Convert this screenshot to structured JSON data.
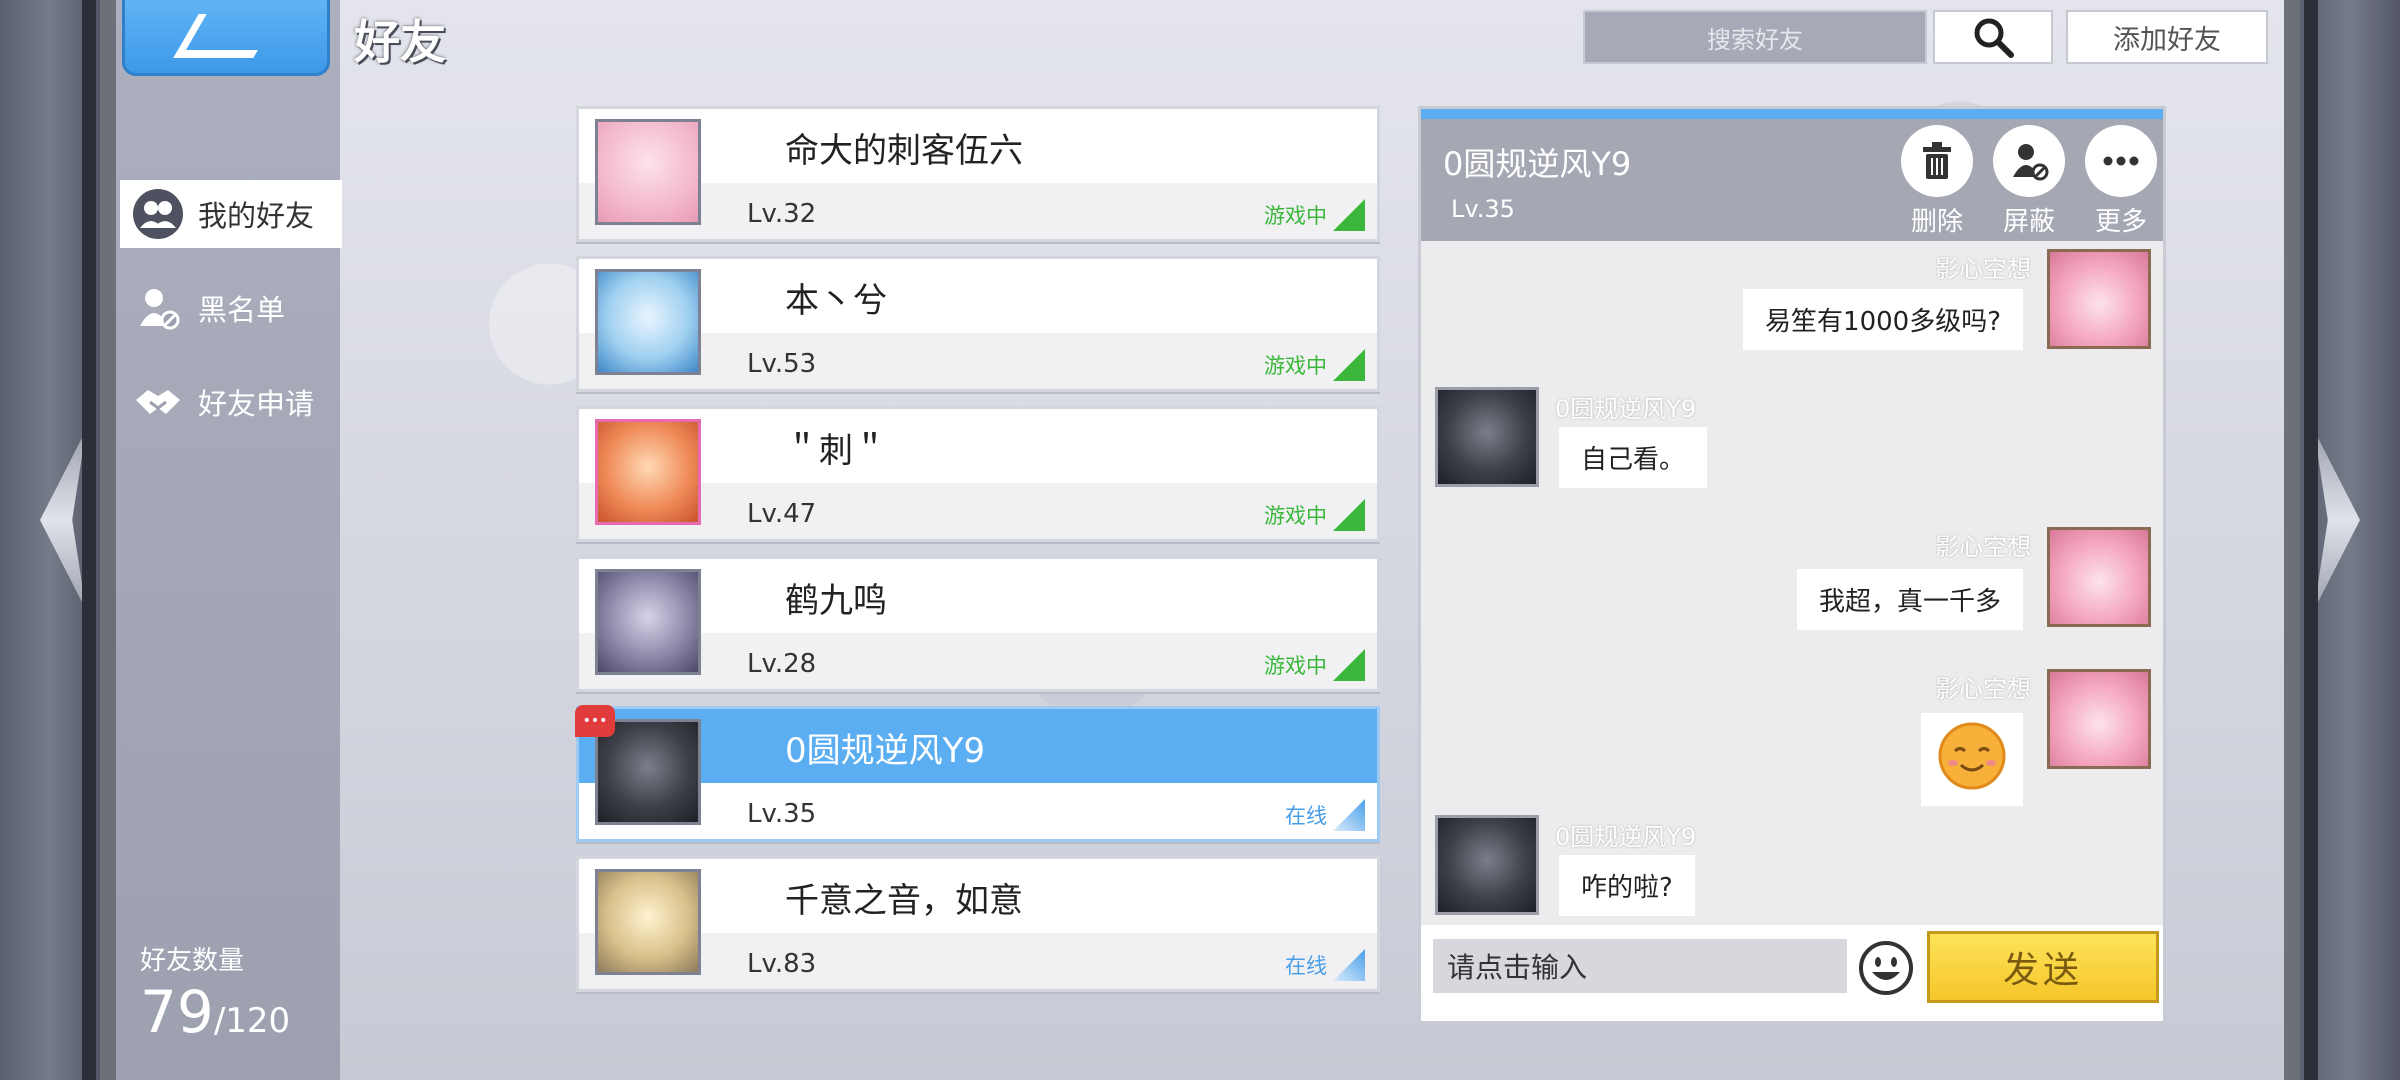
{
  "header": {
    "title": "好友"
  },
  "search": {
    "placeholder": "搜索好友",
    "search_icon": "search-icon",
    "add_friend_label": "添加好友"
  },
  "sidebar": {
    "items": [
      {
        "label": "我的好友",
        "icon": "friends-icon",
        "active": true
      },
      {
        "label": "黑名单",
        "icon": "blocked-user-icon",
        "active": false
      },
      {
        "label": "好友申请",
        "icon": "handshake-icon",
        "active": false
      }
    ],
    "friend_count_label": "好友数量",
    "friend_count": "79",
    "friend_count_max": "/120"
  },
  "friends": [
    {
      "name": "命大的刺客伍六",
      "level": "Lv.32",
      "status": "游戏中",
      "status_color": "#3bb83b",
      "avatar_color": "#f3c3d4"
    },
    {
      "name": "本丶兮",
      "level": "Lv.53",
      "status": "游戏中",
      "status_color": "#3bb83b",
      "avatar_color": "#a9d6f3"
    },
    {
      "name": "＂刺＂",
      "level": "Lv.47",
      "status": "游戏中",
      "status_color": "#3bb83b",
      "avatar_color": "#f08c5a"
    },
    {
      "name": "鹤九鸣",
      "level": "Lv.28",
      "status": "游戏中",
      "status_color": "#3bb83b",
      "avatar_color": "#8d88a8"
    },
    {
      "name": "0圆规逆风Y9",
      "level": "Lv.35",
      "status": "在线",
      "status_color": "#4a9ee8",
      "avatar_color": "#3c4048",
      "selected": true,
      "unread": true
    },
    {
      "name": "千意之音，如意",
      "level": "Lv.83",
      "status": "在线",
      "status_color": "#4a9ee8",
      "avatar_color": "#d8c08a"
    }
  ],
  "chat": {
    "name": "0圆规逆风Y9",
    "level": "Lv.35",
    "actions": [
      {
        "label": "删除",
        "icon": "trash-icon"
      },
      {
        "label": "屏蔽",
        "icon": "block-user-icon"
      },
      {
        "label": "更多",
        "icon": "more-icon"
      }
    ],
    "messages": [
      {
        "side": "right",
        "sender": "影心空想",
        "text": "易笙有1000多级吗?"
      },
      {
        "side": "left",
        "sender": "0圆规逆风Y9",
        "text": "自己看。"
      },
      {
        "side": "right",
        "sender": "影心空想",
        "text": "我超，真一千多"
      },
      {
        "side": "right",
        "sender": "影心空想",
        "text": "",
        "emoji": "smile-emoji-icon"
      },
      {
        "side": "left",
        "sender": "0圆规逆风Y9",
        "text": "咋的啦?"
      }
    ],
    "input_placeholder": "请点击输入",
    "send_label": "发送"
  },
  "colors": {
    "accent": "#5caef2",
    "send": "#f5c62a"
  }
}
